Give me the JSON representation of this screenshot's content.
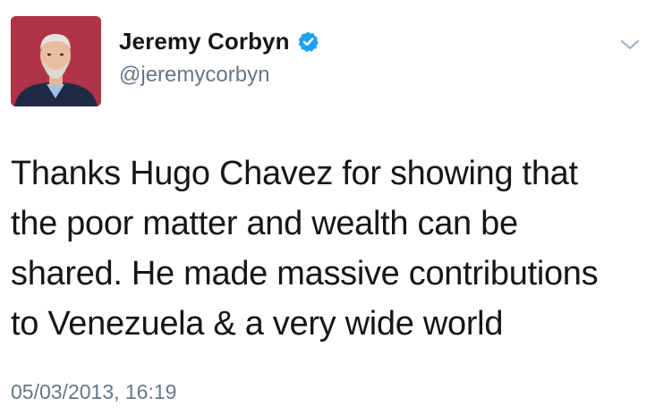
{
  "author": {
    "display_name": "Jeremy Corbyn",
    "handle": "@jeremycorbyn",
    "verified": true,
    "avatar": "profile-photo"
  },
  "tweet": {
    "lines": [
      "Thanks Hugo Chavez for showing that",
      "the poor matter and wealth can be",
      "shared. He made massive contributions",
      "to Venezuela & a very wide world"
    ],
    "timestamp": "05/03/2013, 16:19"
  },
  "icons": {
    "verified": "verified-badge-icon",
    "menu": "chevron-down-icon"
  },
  "colors": {
    "text": "#14171a",
    "secondary": "#657786",
    "verified": "#1da1f2",
    "avatar_bg": "#b23a4a"
  }
}
